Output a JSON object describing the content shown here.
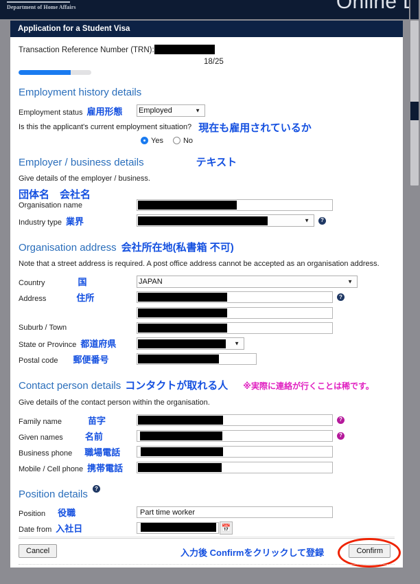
{
  "banner": {
    "agency": "Department of Home Affairs",
    "title": "Online L"
  },
  "card": {
    "header": "Application for a Student Visa"
  },
  "trn": {
    "label": "Transaction Reference Number (TRN):",
    "value": "",
    "page_counter": "18/25",
    "progress_percent": 72
  },
  "employment": {
    "section_title": "Employment history details",
    "status_label": "Employment status",
    "status_label_jp": "雇用形態",
    "status_value": "Employed",
    "current_question": "Is this the applicant's current employment situation?",
    "current_question_jp": "現在も雇用されているか",
    "yes_label": "Yes",
    "no_label": "No",
    "selected": "Yes"
  },
  "employer": {
    "section_title": "Employer / business details",
    "section_note_jp": "テキスト",
    "helptext": "Give details of the employer / business.",
    "org_name_jp": "団体名　会社名",
    "org_name_label": "Organisation name",
    "org_name_value": "",
    "industry_label": "Industry type",
    "industry_label_jp": "業界",
    "industry_value": "",
    "help_icon": "help-icon"
  },
  "org_address": {
    "section_title": "Organisation address",
    "section_title_jp": "会社所在地(私書箱 不可)",
    "helptext": "Note that a street address is required. A post office address cannot be accepted as an organisation address.",
    "country_label": "Country",
    "country_label_jp": "国",
    "country_value": "JAPAN",
    "address_label": "Address",
    "address_label_jp": "住所",
    "address_line1": "",
    "address_line2": "",
    "suburb_label": "Suburb / Town",
    "suburb_value": "",
    "state_label": "State or Province",
    "state_label_jp": "都道府県",
    "state_value": "",
    "postcode_label": "Postal code",
    "postcode_label_jp": "郵便番号",
    "postcode_value": ""
  },
  "contact": {
    "section_title": "Contact person details",
    "section_title_jp": "コンタクトが取れる人",
    "section_note_jp": "※実際に連絡が行くことは稀です。",
    "helptext": "Give details of the contact person within the organisation.",
    "family_name_label": "Family name",
    "family_name_label_jp": "苗字",
    "family_name_value": "",
    "given_names_label": "Given names",
    "given_names_label_jp": "名前",
    "given_names_value": "",
    "business_phone_label": "Business phone",
    "business_phone_label_jp": "職場電話",
    "business_phone_value": "",
    "mobile_label": "Mobile / Cell phone",
    "mobile_label_jp": "携帯電話",
    "mobile_value": ""
  },
  "position": {
    "section_title": "Position details",
    "position_label": "Position",
    "position_label_jp": "役職",
    "position_value": "Part time worker",
    "date_from_label": "Date from",
    "date_from_label_jp": "入社日",
    "date_from_value": "",
    "calendar_icon": "calendar-icon"
  },
  "footer": {
    "cancel_label": "Cancel",
    "confirm_label": "Confirm",
    "note_jp": "入力後 Confirmをクリックして登録"
  },
  "colors": {
    "banner_bg": "#0d1b33",
    "card_header_bg": "#0d2245",
    "section_heading": "#2a6ebb",
    "annotation_blue": "#1450e0",
    "annotation_magenta": "#e020c0",
    "progress_fill": "#1a7bf0",
    "highlight_ring": "#ee2200"
  }
}
